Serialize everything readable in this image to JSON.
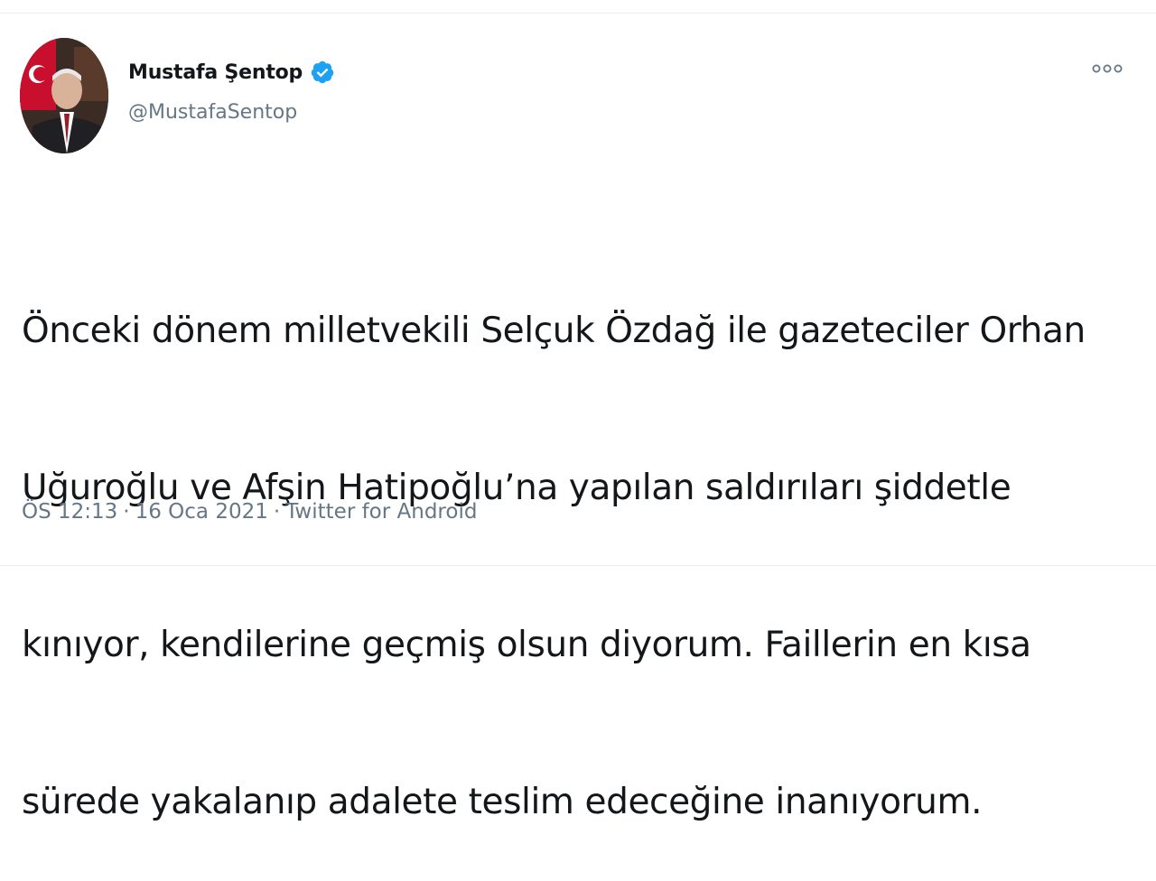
{
  "author": {
    "display_name": "Mustafa Şentop",
    "handle": "@MustafaSentop",
    "verified": true
  },
  "tweet": {
    "lines": [
      "Önceki dönem milletvekili Selçuk Özdağ ile gazeteciler Orhan",
      "Uğuroğlu ve Afşin Hatipoğlu’na yapılan saldırıları şiddetle",
      "kınıyor, kendilerine geçmiş olsun diyorum. Faillerin en kısa",
      "sürede yakalanıp adalete teslim edeceğine inanıyorum."
    ]
  },
  "meta": {
    "time": "ÖS 12:13",
    "separator": "·",
    "date": "16 Oca 2021",
    "source": "Twitter for Android"
  },
  "icons": {
    "verified": "verified-badge-icon",
    "more": "more-options-icon"
  },
  "colors": {
    "text": "#14171a",
    "secondary": "#657786",
    "verified": "#1da1f2",
    "border": "#e6ecf0"
  }
}
